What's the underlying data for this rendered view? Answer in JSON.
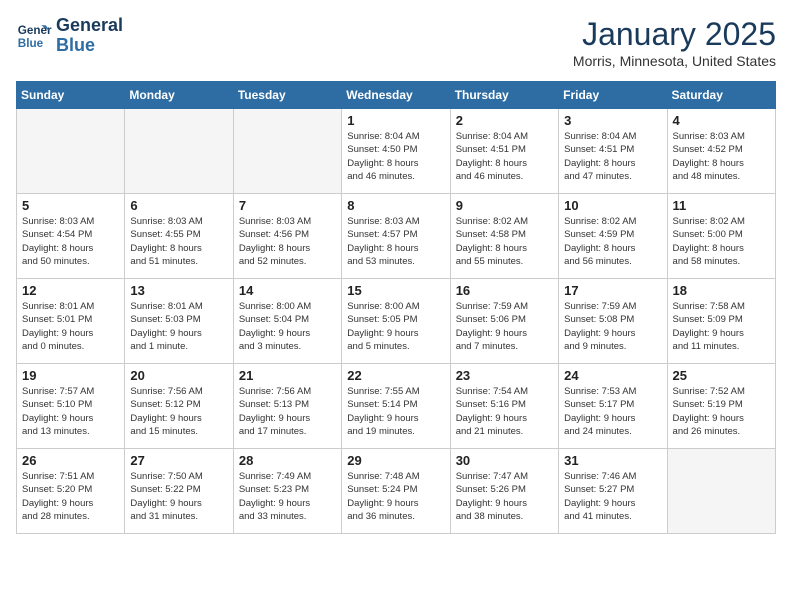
{
  "header": {
    "logo_line1": "General",
    "logo_line2": "Blue",
    "month": "January 2025",
    "location": "Morris, Minnesota, United States"
  },
  "days_of_week": [
    "Sunday",
    "Monday",
    "Tuesday",
    "Wednesday",
    "Thursday",
    "Friday",
    "Saturday"
  ],
  "weeks": [
    [
      {
        "day": "",
        "info": ""
      },
      {
        "day": "",
        "info": ""
      },
      {
        "day": "",
        "info": ""
      },
      {
        "day": "1",
        "info": "Sunrise: 8:04 AM\nSunset: 4:50 PM\nDaylight: 8 hours\nand 46 minutes."
      },
      {
        "day": "2",
        "info": "Sunrise: 8:04 AM\nSunset: 4:51 PM\nDaylight: 8 hours\nand 46 minutes."
      },
      {
        "day": "3",
        "info": "Sunrise: 8:04 AM\nSunset: 4:51 PM\nDaylight: 8 hours\nand 47 minutes."
      },
      {
        "day": "4",
        "info": "Sunrise: 8:03 AM\nSunset: 4:52 PM\nDaylight: 8 hours\nand 48 minutes."
      }
    ],
    [
      {
        "day": "5",
        "info": "Sunrise: 8:03 AM\nSunset: 4:54 PM\nDaylight: 8 hours\nand 50 minutes."
      },
      {
        "day": "6",
        "info": "Sunrise: 8:03 AM\nSunset: 4:55 PM\nDaylight: 8 hours\nand 51 minutes."
      },
      {
        "day": "7",
        "info": "Sunrise: 8:03 AM\nSunset: 4:56 PM\nDaylight: 8 hours\nand 52 minutes."
      },
      {
        "day": "8",
        "info": "Sunrise: 8:03 AM\nSunset: 4:57 PM\nDaylight: 8 hours\nand 53 minutes."
      },
      {
        "day": "9",
        "info": "Sunrise: 8:02 AM\nSunset: 4:58 PM\nDaylight: 8 hours\nand 55 minutes."
      },
      {
        "day": "10",
        "info": "Sunrise: 8:02 AM\nSunset: 4:59 PM\nDaylight: 8 hours\nand 56 minutes."
      },
      {
        "day": "11",
        "info": "Sunrise: 8:02 AM\nSunset: 5:00 PM\nDaylight: 8 hours\nand 58 minutes."
      }
    ],
    [
      {
        "day": "12",
        "info": "Sunrise: 8:01 AM\nSunset: 5:01 PM\nDaylight: 9 hours\nand 0 minutes."
      },
      {
        "day": "13",
        "info": "Sunrise: 8:01 AM\nSunset: 5:03 PM\nDaylight: 9 hours\nand 1 minute."
      },
      {
        "day": "14",
        "info": "Sunrise: 8:00 AM\nSunset: 5:04 PM\nDaylight: 9 hours\nand 3 minutes."
      },
      {
        "day": "15",
        "info": "Sunrise: 8:00 AM\nSunset: 5:05 PM\nDaylight: 9 hours\nand 5 minutes."
      },
      {
        "day": "16",
        "info": "Sunrise: 7:59 AM\nSunset: 5:06 PM\nDaylight: 9 hours\nand 7 minutes."
      },
      {
        "day": "17",
        "info": "Sunrise: 7:59 AM\nSunset: 5:08 PM\nDaylight: 9 hours\nand 9 minutes."
      },
      {
        "day": "18",
        "info": "Sunrise: 7:58 AM\nSunset: 5:09 PM\nDaylight: 9 hours\nand 11 minutes."
      }
    ],
    [
      {
        "day": "19",
        "info": "Sunrise: 7:57 AM\nSunset: 5:10 PM\nDaylight: 9 hours\nand 13 minutes."
      },
      {
        "day": "20",
        "info": "Sunrise: 7:56 AM\nSunset: 5:12 PM\nDaylight: 9 hours\nand 15 minutes."
      },
      {
        "day": "21",
        "info": "Sunrise: 7:56 AM\nSunset: 5:13 PM\nDaylight: 9 hours\nand 17 minutes."
      },
      {
        "day": "22",
        "info": "Sunrise: 7:55 AM\nSunset: 5:14 PM\nDaylight: 9 hours\nand 19 minutes."
      },
      {
        "day": "23",
        "info": "Sunrise: 7:54 AM\nSunset: 5:16 PM\nDaylight: 9 hours\nand 21 minutes."
      },
      {
        "day": "24",
        "info": "Sunrise: 7:53 AM\nSunset: 5:17 PM\nDaylight: 9 hours\nand 24 minutes."
      },
      {
        "day": "25",
        "info": "Sunrise: 7:52 AM\nSunset: 5:19 PM\nDaylight: 9 hours\nand 26 minutes."
      }
    ],
    [
      {
        "day": "26",
        "info": "Sunrise: 7:51 AM\nSunset: 5:20 PM\nDaylight: 9 hours\nand 28 minutes."
      },
      {
        "day": "27",
        "info": "Sunrise: 7:50 AM\nSunset: 5:22 PM\nDaylight: 9 hours\nand 31 minutes."
      },
      {
        "day": "28",
        "info": "Sunrise: 7:49 AM\nSunset: 5:23 PM\nDaylight: 9 hours\nand 33 minutes."
      },
      {
        "day": "29",
        "info": "Sunrise: 7:48 AM\nSunset: 5:24 PM\nDaylight: 9 hours\nand 36 minutes."
      },
      {
        "day": "30",
        "info": "Sunrise: 7:47 AM\nSunset: 5:26 PM\nDaylight: 9 hours\nand 38 minutes."
      },
      {
        "day": "31",
        "info": "Sunrise: 7:46 AM\nSunset: 5:27 PM\nDaylight: 9 hours\nand 41 minutes."
      },
      {
        "day": "",
        "info": ""
      }
    ]
  ]
}
